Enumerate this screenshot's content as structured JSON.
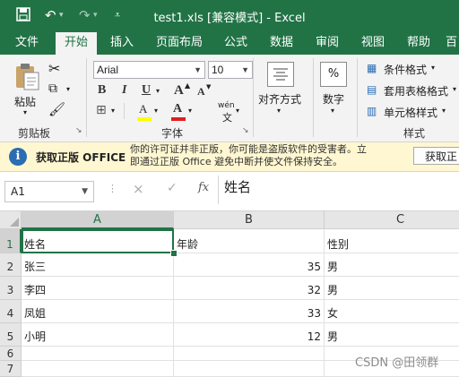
{
  "app": {
    "title": "test1.xls  [兼容模式]  -  Excel",
    "quick_access": {
      "save_icon": "save-icon",
      "undo_icon": "undo-icon",
      "redo_icon": "redo-icon",
      "customize_icon": "customize-toolbar-icon"
    }
  },
  "tabs": [
    "文件",
    "开始",
    "插入",
    "页面布局",
    "公式",
    "数据",
    "审阅",
    "视图",
    "帮助",
    "百"
  ],
  "active_tab": "开始",
  "ribbon": {
    "clipboard": {
      "paste_label": "粘贴",
      "group_label": "剪贴板"
    },
    "font": {
      "font_name": "Arial",
      "font_size": "10",
      "bold": "B",
      "italic": "I",
      "underline": "U",
      "grow_font": "A",
      "shrink_font": "A",
      "font_color_letter": "A",
      "highlight_letter": "A",
      "phonetic": "wén",
      "group_label": "字体"
    },
    "alignment": {
      "label": "对齐方式"
    },
    "number": {
      "symbol": "%",
      "label": "数字"
    },
    "styles": {
      "conditional_formatting": "条件格式",
      "format_as_table": "套用表格格式",
      "cell_styles": "单元格样式",
      "group_label": "样式"
    }
  },
  "security_bar": {
    "headline": "获取正版 OFFICE",
    "message_line1": "你的许可证并非正版，你可能是盗版软件的受害者。立",
    "message_line2": "即通过正版 Office 避免中断并使文件保持安全。",
    "button_label": "获取正"
  },
  "formula_bar": {
    "name_box": "A1",
    "cancel_icon": "×",
    "enter_icon": "✓",
    "fx_label": "fx",
    "content": "姓名"
  },
  "sheet": {
    "columns": [
      "A",
      "B",
      "C"
    ],
    "rows": [
      {
        "num": "1",
        "a": "姓名",
        "b": "年龄",
        "c": "性别"
      },
      {
        "num": "2",
        "a": "张三",
        "b": "35",
        "c": "男"
      },
      {
        "num": "3",
        "a": "李四",
        "b": "32",
        "c": "男"
      },
      {
        "num": "4",
        "a": "凤姐",
        "b": "33",
        "c": "女"
      },
      {
        "num": "5",
        "a": "小明",
        "b": "12",
        "c": "男"
      },
      {
        "num": "6",
        "a": "",
        "b": "",
        "c": ""
      },
      {
        "num": "7",
        "a": "",
        "b": "",
        "c": ""
      }
    ],
    "selected_cell": "A1"
  },
  "watermark": "CSDN @田领群",
  "colors": {
    "excel_green": "#217346",
    "ribbon_bg": "#f3f3f3",
    "warning_bg": "#fff7d1"
  }
}
